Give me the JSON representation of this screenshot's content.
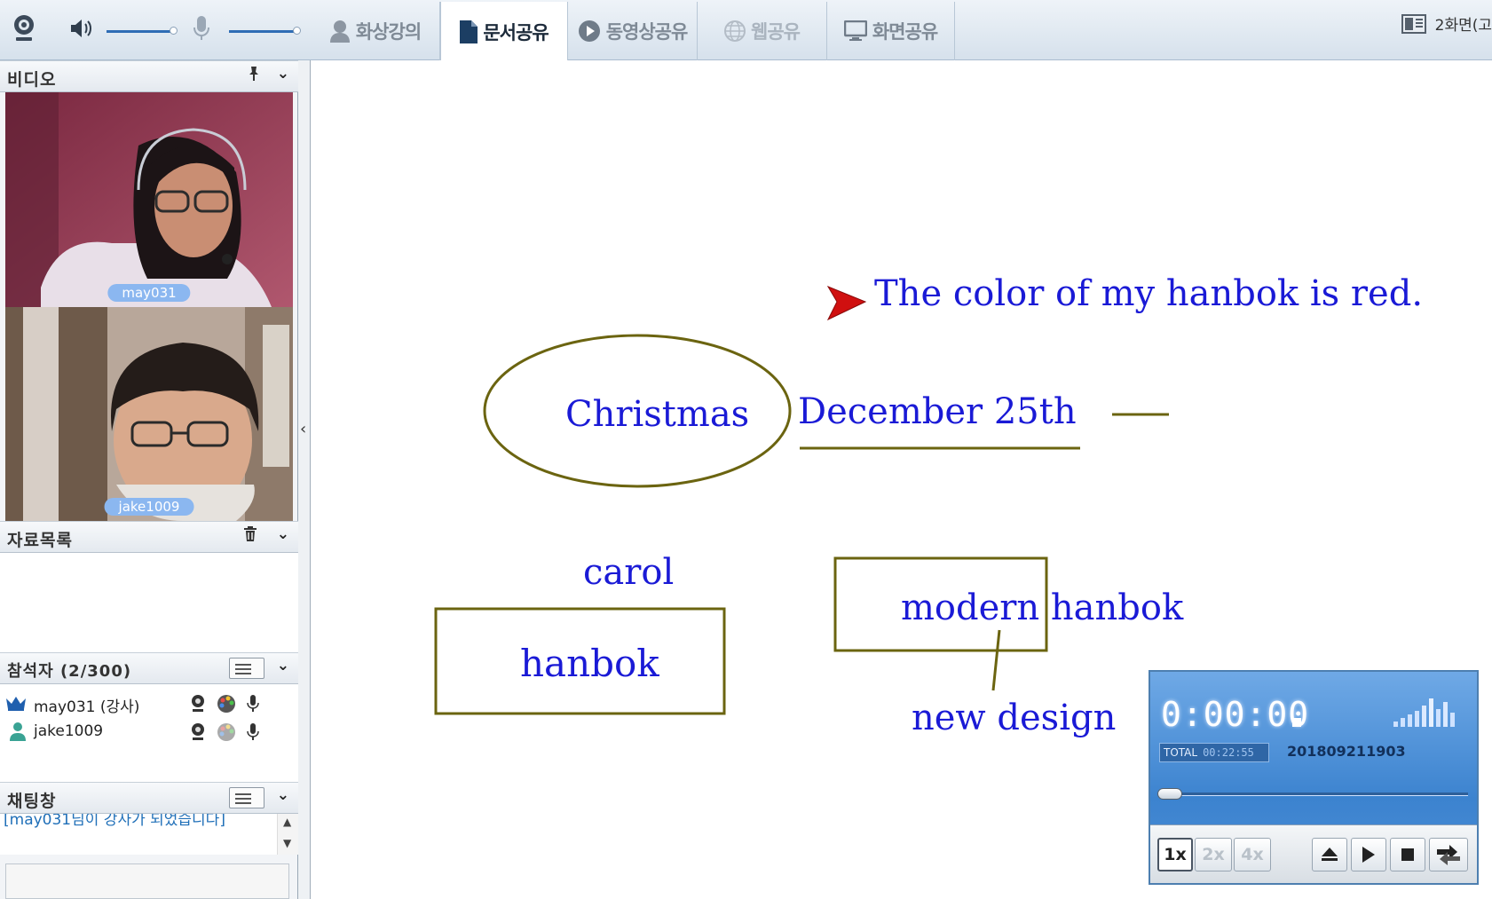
{
  "toolbar": {
    "tabs": [
      {
        "label": "화상강의",
        "icon": "person-icon",
        "state": "normal"
      },
      {
        "label": "문서공유",
        "icon": "document-icon",
        "state": "active"
      },
      {
        "label": "동영상공유",
        "icon": "play-circle-icon",
        "state": "normal"
      },
      {
        "label": "웹공유",
        "icon": "globe-icon",
        "state": "disabled"
      },
      {
        "label": "화면공유",
        "icon": "monitor-icon",
        "state": "normal"
      }
    ],
    "split_label": "2화면(고"
  },
  "sidebar": {
    "video": {
      "title": "비디오",
      "feeds": [
        {
          "name": "may031"
        },
        {
          "name": "jake1009"
        }
      ]
    },
    "materials": {
      "title": "자료목록"
    },
    "participants": {
      "title": "참석자 (2/300)",
      "list": [
        {
          "name": "may031 (강사)",
          "role": "instructor"
        },
        {
          "name": "jake1009",
          "role": "student"
        }
      ]
    },
    "chat": {
      "title": "채팅창",
      "messages": [
        "[may031님이 강사가 되었습니다]"
      ],
      "input_value": ""
    }
  },
  "canvas": {
    "sentence": "The color of my hanbok is red.",
    "labels": {
      "christmas": "Christmas",
      "december": "December 25th",
      "carol": "carol",
      "hanbok": "hanbok",
      "modern_hanbok": "modern hanbok",
      "new_design": "new design"
    },
    "text_color": "#1a1ad6",
    "shape_color": "#6b6410",
    "pointer_color": "#d01010"
  },
  "player": {
    "time": "0:00:00",
    "total_label": "TOTAL",
    "total_time": "00:22:55",
    "recording_id": "201809211903",
    "progress": 0,
    "speeds": [
      "1x",
      "2x",
      "4x"
    ],
    "selected_speed": "1x"
  }
}
